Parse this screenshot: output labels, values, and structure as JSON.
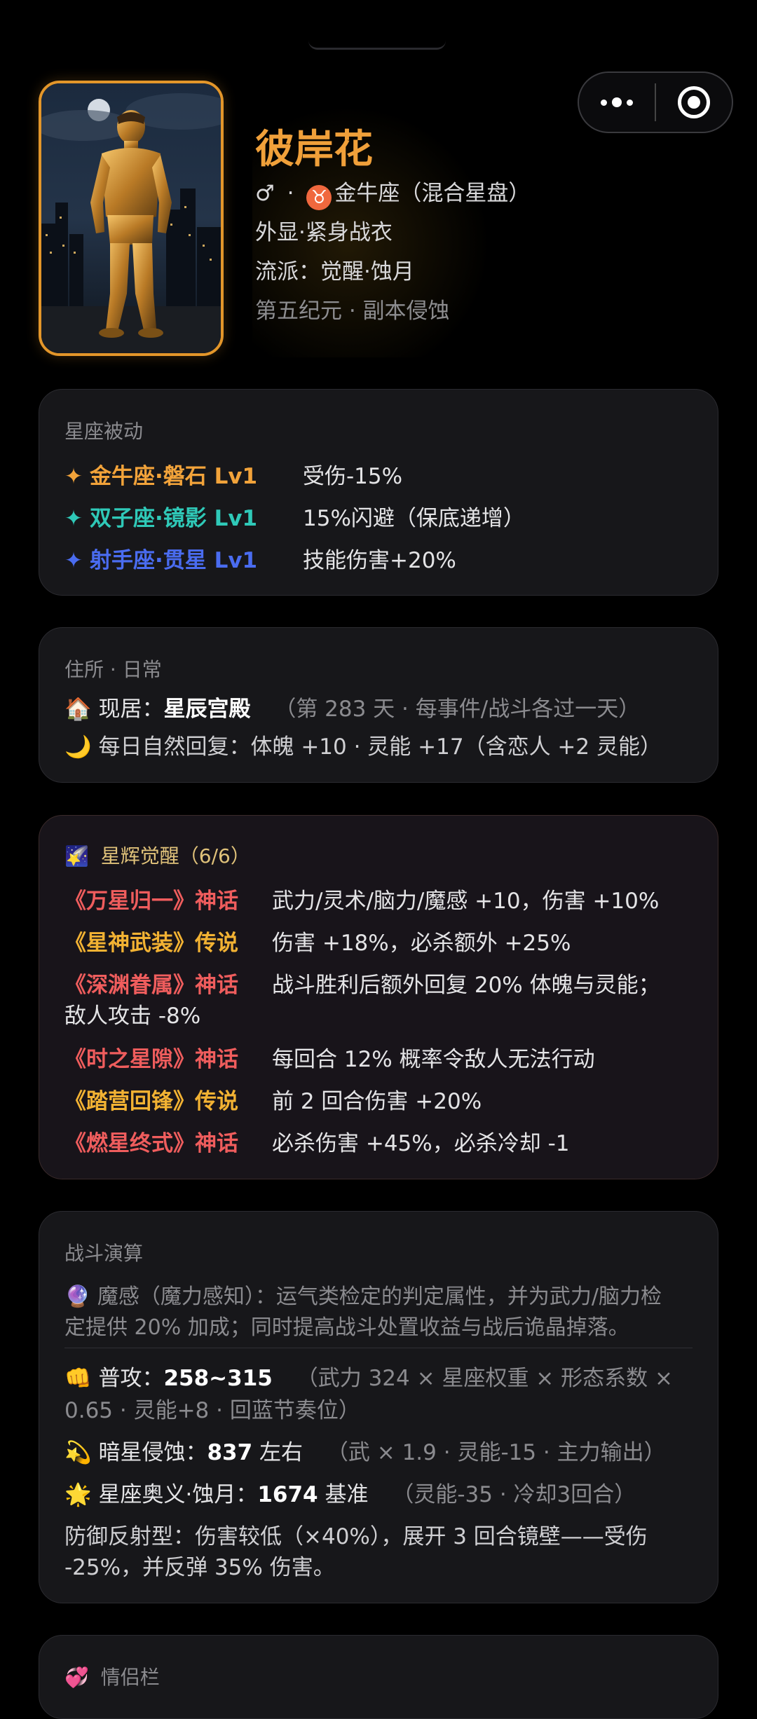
{
  "hero": {
    "name": "彼岸花",
    "gender_symbol": "♂",
    "sign_dot": "·",
    "zodiac_symbol": "♉",
    "zodiac": "金牛座（混合星盘）",
    "appearance": "外显·紧身战衣",
    "school": "流派：觉醒·蚀月",
    "era": "第五纪元 · 副本侵蚀"
  },
  "passives": {
    "title": "星座被动",
    "items": [
      {
        "name": "金牛座·磐石 Lv1",
        "effect": "受伤-15%",
        "color": "#f2a33a"
      },
      {
        "name": "双子座·镜影 Lv1",
        "effect": "15%闪避（保底递增）",
        "color": "#2fc9b8"
      },
      {
        "name": "射手座·贯星 Lv1",
        "effect": "技能伤害+20%",
        "color": "#4a6cf0"
      }
    ]
  },
  "residence": {
    "title": "住所 · 日常",
    "home_icon": "🏠",
    "home_label": "现居：",
    "home_value": "星辰宫殿",
    "home_note": "（第 283 天 · 每事件/战斗各过一天）",
    "moon_icon": "🌙",
    "recovery": "每日自然回复：体魄 +10 · 灵能 +17（含恋人 +2 灵能）"
  },
  "awaken": {
    "icon": "🌠",
    "title": "星辉觉醒（6/6）",
    "items": [
      {
        "name": "《万星归一》神话",
        "tier": "myth",
        "effect": "武力/灵术/脑力/魔感 +10，伤害 +10%"
      },
      {
        "name": "《星神武装》传说",
        "tier": "legend",
        "effect": "伤害 +18%，必杀额外 +25%"
      },
      {
        "name": "《深渊眷属》神话",
        "tier": "myth",
        "effect": "战斗胜利后额外回复 20% 体魄与灵能；",
        "effect2": "敌人攻击 -8%"
      },
      {
        "name": "《时之星隙》神话",
        "tier": "myth",
        "effect": "每回合 12% 概率令敌人无法行动"
      },
      {
        "name": "《踏营回锋》传说",
        "tier": "legend",
        "effect": "前 2 回合伤害 +20%"
      },
      {
        "name": "《燃星终式》神话",
        "tier": "myth",
        "effect": "必杀伤害 +45%，必杀冷却 -1"
      }
    ]
  },
  "battle": {
    "title": "战斗演算",
    "orb_icon": "🔮",
    "magic_line1": "魔感（魔力感知）：运气类检定的判定属性，并为武力/脑力检",
    "magic_line2": "定提供 20% 加成；同时提高战斗处置收益与战后诡晶掉落。",
    "attack_icon": "👊",
    "attack_label": "普攻：",
    "attack_value": "258~315",
    "attack_note1": "（武力 324 × 星座权重 × 形态系数 ×",
    "attack_note2": "0.65 · 灵能+8 · 回蓝节奏位）",
    "dark_icon": "💫",
    "dark_label": "暗星侵蚀：",
    "dark_value": "837",
    "dark_suffix": " 左右",
    "dark_note": "（武 × 1.9 · 灵能-15 · 主力输出）",
    "ult_icon": "🌟",
    "ult_label": "星座奥义·蚀月：",
    "ult_value": "1674",
    "ult_suffix": " 基准",
    "ult_note": "（灵能-35 · 冷却3回合）",
    "reflect_line1": "防御反射型：伤害较低（×40%），展开 3 回合镜壁——受伤",
    "reflect_line2": "-25%，并反弹 35% 伤害。"
  },
  "couple": {
    "icon": "💞",
    "title": "情侣栏"
  },
  "colors": {
    "accent": "#f0a03a",
    "myth": "#ef5d5d",
    "legend": "#f2b233"
  }
}
